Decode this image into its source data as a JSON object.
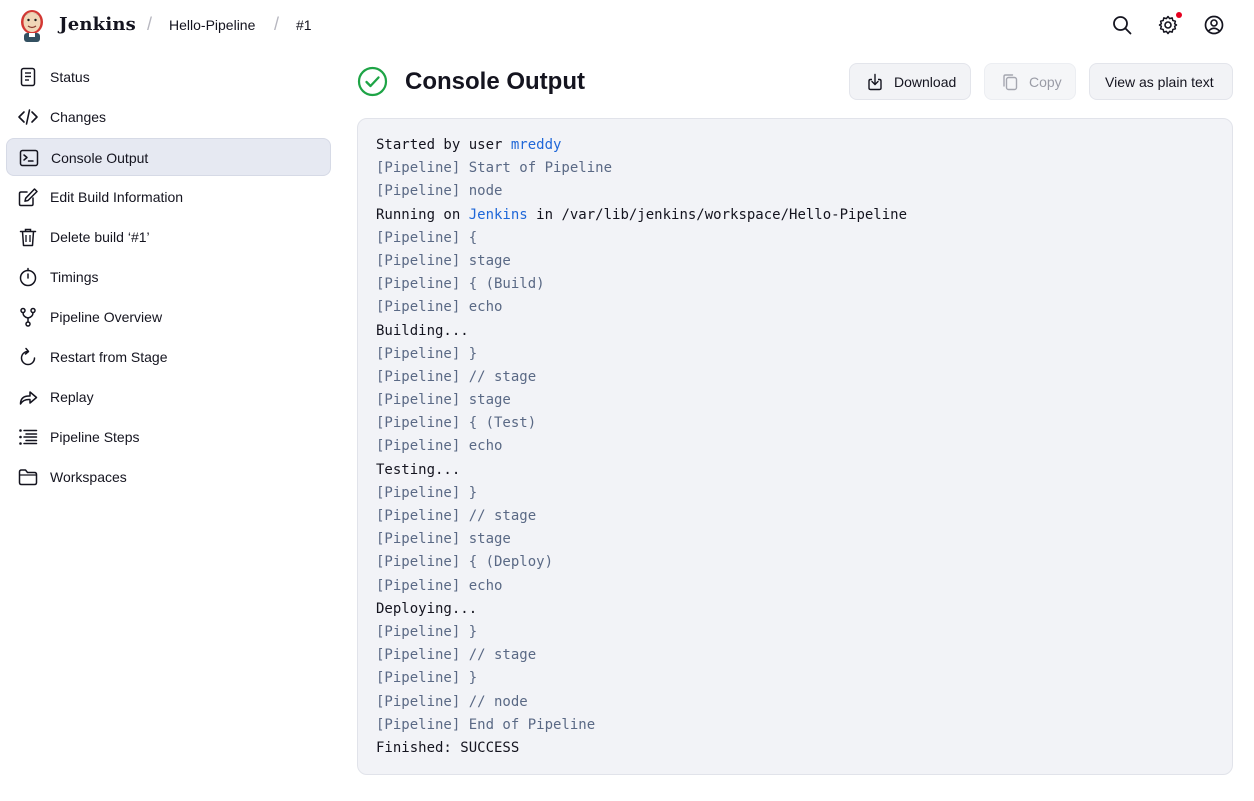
{
  "header": {
    "brand": "Jenkins",
    "breadcrumbs": [
      "Hello-Pipeline",
      "#1"
    ],
    "icons": [
      "search-icon",
      "settings-icon",
      "user-icon"
    ],
    "notification_color": "#e6001f"
  },
  "sidebar": {
    "items": [
      {
        "label": "Status",
        "icon": "document-icon"
      },
      {
        "label": "Changes",
        "icon": "code-icon"
      },
      {
        "label": "Console Output",
        "icon": "terminal-icon",
        "active": true
      },
      {
        "label": "Edit Build Information",
        "icon": "edit-icon"
      },
      {
        "label": "Delete build ‘#1’",
        "icon": "trash-icon"
      },
      {
        "label": "Timings",
        "icon": "timer-icon"
      },
      {
        "label": "Pipeline Overview",
        "icon": "branch-icon"
      },
      {
        "label": "Restart from Stage",
        "icon": "restart-icon"
      },
      {
        "label": "Replay",
        "icon": "replay-icon"
      },
      {
        "label": "Pipeline Steps",
        "icon": "steps-icon"
      },
      {
        "label": "Workspaces",
        "icon": "folder-icon"
      }
    ]
  },
  "main": {
    "title": "Console Output",
    "status_color": "#1ea446",
    "buttons": {
      "download": "Download",
      "copy": "Copy",
      "plain_text": "View as plain text"
    }
  },
  "console": {
    "lines": [
      [
        {
          "t": "Started by user ",
          "k": "plain"
        },
        {
          "t": "mreddy",
          "k": "link"
        }
      ],
      [
        {
          "t": "[Pipeline] Start of Pipeline",
          "k": "pipe"
        }
      ],
      [
        {
          "t": "[Pipeline] node",
          "k": "pipe"
        }
      ],
      [
        {
          "t": "Running on ",
          "k": "plain"
        },
        {
          "t": "Jenkins",
          "k": "link"
        },
        {
          "t": " in /var/lib/jenkins/workspace/Hello-Pipeline",
          "k": "plain"
        }
      ],
      [
        {
          "t": "[Pipeline] {",
          "k": "pipe"
        }
      ],
      [
        {
          "t": "[Pipeline] stage",
          "k": "pipe"
        }
      ],
      [
        {
          "t": "[Pipeline] { (Build)",
          "k": "pipe"
        }
      ],
      [
        {
          "t": "[Pipeline] echo",
          "k": "pipe"
        }
      ],
      [
        {
          "t": "Building...",
          "k": "plain"
        }
      ],
      [
        {
          "t": "[Pipeline] }",
          "k": "pipe"
        }
      ],
      [
        {
          "t": "[Pipeline] // stage",
          "k": "pipe"
        }
      ],
      [
        {
          "t": "[Pipeline] stage",
          "k": "pipe"
        }
      ],
      [
        {
          "t": "[Pipeline] { (Test)",
          "k": "pipe"
        }
      ],
      [
        {
          "t": "[Pipeline] echo",
          "k": "pipe"
        }
      ],
      [
        {
          "t": "Testing...",
          "k": "plain"
        }
      ],
      [
        {
          "t": "[Pipeline] }",
          "k": "pipe"
        }
      ],
      [
        {
          "t": "[Pipeline] // stage",
          "k": "pipe"
        }
      ],
      [
        {
          "t": "[Pipeline] stage",
          "k": "pipe"
        }
      ],
      [
        {
          "t": "[Pipeline] { (Deploy)",
          "k": "pipe"
        }
      ],
      [
        {
          "t": "[Pipeline] echo",
          "k": "pipe"
        }
      ],
      [
        {
          "t": "Deploying...",
          "k": "plain"
        }
      ],
      [
        {
          "t": "[Pipeline] }",
          "k": "pipe"
        }
      ],
      [
        {
          "t": "[Pipeline] // stage",
          "k": "pipe"
        }
      ],
      [
        {
          "t": "[Pipeline] }",
          "k": "pipe"
        }
      ],
      [
        {
          "t": "[Pipeline] // node",
          "k": "pipe"
        }
      ],
      [
        {
          "t": "[Pipeline] End of Pipeline",
          "k": "pipe"
        }
      ],
      [
        {
          "t": "Finished: SUCCESS",
          "k": "plain"
        }
      ]
    ]
  }
}
